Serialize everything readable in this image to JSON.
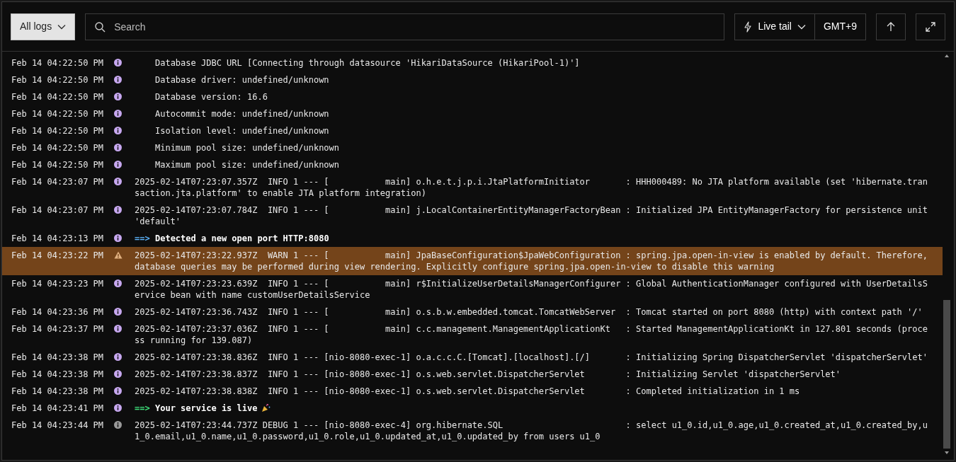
{
  "toolbar": {
    "log_filter": "All logs",
    "search": {
      "placeholder": "Search"
    },
    "live_tail": "Live tail",
    "timezone": "GMT+9"
  },
  "logs": [
    {
      "time": "Feb 14 04:22:50 PM",
      "kind": "info",
      "message": "    Database JDBC URL [Connecting through datasource 'HikariDataSource (HikariPool-1)']"
    },
    {
      "time": "Feb 14 04:22:50 PM",
      "kind": "info",
      "message": "    Database driver: undefined/unknown"
    },
    {
      "time": "Feb 14 04:22:50 PM",
      "kind": "info",
      "message": "    Database version: 16.6"
    },
    {
      "time": "Feb 14 04:22:50 PM",
      "kind": "info",
      "message": "    Autocommit mode: undefined/unknown"
    },
    {
      "time": "Feb 14 04:22:50 PM",
      "kind": "info",
      "message": "    Isolation level: undefined/unknown"
    },
    {
      "time": "Feb 14 04:22:50 PM",
      "kind": "info",
      "message": "    Minimum pool size: undefined/unknown"
    },
    {
      "time": "Feb 14 04:22:50 PM",
      "kind": "info",
      "message": "    Maximum pool size: undefined/unknown"
    },
    {
      "time": "Feb 14 04:23:07 PM",
      "kind": "info",
      "message": "2025-02-14T07:23:07.357Z  INFO 1 --- [           main] o.h.e.t.j.p.i.JtaPlatformInitiator       : HHH000489: No JTA platform available (set 'hibernate.transaction.jta.platform' to enable JTA platform integration)"
    },
    {
      "time": "Feb 14 04:23:07 PM",
      "kind": "info",
      "message": "2025-02-14T07:23:07.784Z  INFO 1 --- [           main] j.LocalContainerEntityManagerFactoryBean : Initialized JPA EntityManagerFactory for persistence unit 'default'"
    },
    {
      "time": "Feb 14 04:23:13 PM",
      "kind": "info",
      "arrow": "==>",
      "color": "#5ab0f7",
      "message": "Detected a new open port HTTP:8080"
    },
    {
      "time": "Feb 14 04:23:22 PM",
      "kind": "warn",
      "message": "2025-02-14T07:23:22.937Z  WARN 1 --- [           main] JpaBaseConfiguration$JpaWebConfiguration : spring.jpa.open-in-view is enabled by default. Therefore, database queries may be performed during view rendering. Explicitly configure spring.jpa.open-in-view to disable this warning"
    },
    {
      "time": "Feb 14 04:23:23 PM",
      "kind": "info",
      "message": "2025-02-14T07:23:23.639Z  INFO 1 --- [           main] r$InitializeUserDetailsManagerConfigurer : Global AuthenticationManager configured with UserDetailsService bean with name customUserDetailsService"
    },
    {
      "time": "Feb 14 04:23:36 PM",
      "kind": "info",
      "message": "2025-02-14T07:23:36.743Z  INFO 1 --- [           main] o.s.b.w.embedded.tomcat.TomcatWebServer  : Tomcat started on port 8080 (http) with context path '/'"
    },
    {
      "time": "Feb 14 04:23:37 PM",
      "kind": "info",
      "message": "2025-02-14T07:23:37.036Z  INFO 1 --- [           main] c.c.management.ManagementApplicationKt   : Started ManagementApplicationKt in 127.801 seconds (process running for 139.087)"
    },
    {
      "time": "Feb 14 04:23:38 PM",
      "kind": "info",
      "message": "2025-02-14T07:23:38.836Z  INFO 1 --- [nio-8080-exec-1] o.a.c.c.C.[Tomcat].[localhost].[/]       : Initializing Spring DispatcherServlet 'dispatcherServlet'"
    },
    {
      "time": "Feb 14 04:23:38 PM",
      "kind": "info",
      "message": "2025-02-14T07:23:38.837Z  INFO 1 --- [nio-8080-exec-1] o.s.web.servlet.DispatcherServlet        : Initializing Servlet 'dispatcherServlet'"
    },
    {
      "time": "Feb 14 04:23:38 PM",
      "kind": "info",
      "message": "2025-02-14T07:23:38.838Z  INFO 1 --- [nio-8080-exec-1] o.s.web.servlet.DispatcherServlet        : Completed initialization in 1 ms"
    },
    {
      "time": "Feb 14 04:23:41 PM",
      "kind": "info",
      "arrow": "==>",
      "color": "#3ee07a",
      "message": "Your service is live",
      "emoji": true
    },
    {
      "time": "Feb 14 04:23:44 PM",
      "kind": "debug",
      "message": "2025-02-14T07:23:44.737Z DEBUG 1 --- [nio-8080-exec-4] org.hibernate.SQL                        : select u1_0.id,u1_0.age,u1_0.created_at,u1_0.created_by,u1_0.email,u1_0.name,u1_0.password,u1_0.role,u1_0.updated_at,u1_0.updated_by from users u1_0"
    }
  ]
}
